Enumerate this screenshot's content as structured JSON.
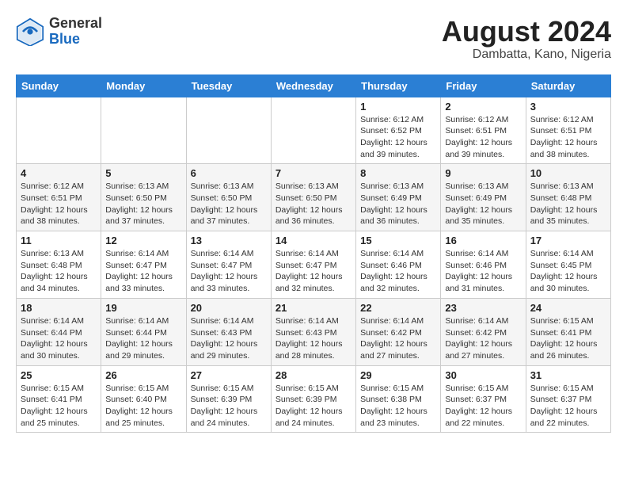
{
  "header": {
    "logo_general": "General",
    "logo_blue": "Blue",
    "month_title": "August 2024",
    "location": "Dambatta, Kano, Nigeria"
  },
  "weekdays": [
    "Sunday",
    "Monday",
    "Tuesday",
    "Wednesday",
    "Thursday",
    "Friday",
    "Saturday"
  ],
  "weeks": [
    [
      {
        "day": "",
        "info": ""
      },
      {
        "day": "",
        "info": ""
      },
      {
        "day": "",
        "info": ""
      },
      {
        "day": "",
        "info": ""
      },
      {
        "day": "1",
        "info": "Sunrise: 6:12 AM\nSunset: 6:52 PM\nDaylight: 12 hours\nand 39 minutes."
      },
      {
        "day": "2",
        "info": "Sunrise: 6:12 AM\nSunset: 6:51 PM\nDaylight: 12 hours\nand 39 minutes."
      },
      {
        "day": "3",
        "info": "Sunrise: 6:12 AM\nSunset: 6:51 PM\nDaylight: 12 hours\nand 38 minutes."
      }
    ],
    [
      {
        "day": "4",
        "info": "Sunrise: 6:12 AM\nSunset: 6:51 PM\nDaylight: 12 hours\nand 38 minutes."
      },
      {
        "day": "5",
        "info": "Sunrise: 6:13 AM\nSunset: 6:50 PM\nDaylight: 12 hours\nand 37 minutes."
      },
      {
        "day": "6",
        "info": "Sunrise: 6:13 AM\nSunset: 6:50 PM\nDaylight: 12 hours\nand 37 minutes."
      },
      {
        "day": "7",
        "info": "Sunrise: 6:13 AM\nSunset: 6:50 PM\nDaylight: 12 hours\nand 36 minutes."
      },
      {
        "day": "8",
        "info": "Sunrise: 6:13 AM\nSunset: 6:49 PM\nDaylight: 12 hours\nand 36 minutes."
      },
      {
        "day": "9",
        "info": "Sunrise: 6:13 AM\nSunset: 6:49 PM\nDaylight: 12 hours\nand 35 minutes."
      },
      {
        "day": "10",
        "info": "Sunrise: 6:13 AM\nSunset: 6:48 PM\nDaylight: 12 hours\nand 35 minutes."
      }
    ],
    [
      {
        "day": "11",
        "info": "Sunrise: 6:13 AM\nSunset: 6:48 PM\nDaylight: 12 hours\nand 34 minutes."
      },
      {
        "day": "12",
        "info": "Sunrise: 6:14 AM\nSunset: 6:47 PM\nDaylight: 12 hours\nand 33 minutes."
      },
      {
        "day": "13",
        "info": "Sunrise: 6:14 AM\nSunset: 6:47 PM\nDaylight: 12 hours\nand 33 minutes."
      },
      {
        "day": "14",
        "info": "Sunrise: 6:14 AM\nSunset: 6:47 PM\nDaylight: 12 hours\nand 32 minutes."
      },
      {
        "day": "15",
        "info": "Sunrise: 6:14 AM\nSunset: 6:46 PM\nDaylight: 12 hours\nand 32 minutes."
      },
      {
        "day": "16",
        "info": "Sunrise: 6:14 AM\nSunset: 6:46 PM\nDaylight: 12 hours\nand 31 minutes."
      },
      {
        "day": "17",
        "info": "Sunrise: 6:14 AM\nSunset: 6:45 PM\nDaylight: 12 hours\nand 30 minutes."
      }
    ],
    [
      {
        "day": "18",
        "info": "Sunrise: 6:14 AM\nSunset: 6:44 PM\nDaylight: 12 hours\nand 30 minutes."
      },
      {
        "day": "19",
        "info": "Sunrise: 6:14 AM\nSunset: 6:44 PM\nDaylight: 12 hours\nand 29 minutes."
      },
      {
        "day": "20",
        "info": "Sunrise: 6:14 AM\nSunset: 6:43 PM\nDaylight: 12 hours\nand 29 minutes."
      },
      {
        "day": "21",
        "info": "Sunrise: 6:14 AM\nSunset: 6:43 PM\nDaylight: 12 hours\nand 28 minutes."
      },
      {
        "day": "22",
        "info": "Sunrise: 6:14 AM\nSunset: 6:42 PM\nDaylight: 12 hours\nand 27 minutes."
      },
      {
        "day": "23",
        "info": "Sunrise: 6:14 AM\nSunset: 6:42 PM\nDaylight: 12 hours\nand 27 minutes."
      },
      {
        "day": "24",
        "info": "Sunrise: 6:15 AM\nSunset: 6:41 PM\nDaylight: 12 hours\nand 26 minutes."
      }
    ],
    [
      {
        "day": "25",
        "info": "Sunrise: 6:15 AM\nSunset: 6:41 PM\nDaylight: 12 hours\nand 25 minutes."
      },
      {
        "day": "26",
        "info": "Sunrise: 6:15 AM\nSunset: 6:40 PM\nDaylight: 12 hours\nand 25 minutes."
      },
      {
        "day": "27",
        "info": "Sunrise: 6:15 AM\nSunset: 6:39 PM\nDaylight: 12 hours\nand 24 minutes."
      },
      {
        "day": "28",
        "info": "Sunrise: 6:15 AM\nSunset: 6:39 PM\nDaylight: 12 hours\nand 24 minutes."
      },
      {
        "day": "29",
        "info": "Sunrise: 6:15 AM\nSunset: 6:38 PM\nDaylight: 12 hours\nand 23 minutes."
      },
      {
        "day": "30",
        "info": "Sunrise: 6:15 AM\nSunset: 6:37 PM\nDaylight: 12 hours\nand 22 minutes."
      },
      {
        "day": "31",
        "info": "Sunrise: 6:15 AM\nSunset: 6:37 PM\nDaylight: 12 hours\nand 22 minutes."
      }
    ]
  ]
}
